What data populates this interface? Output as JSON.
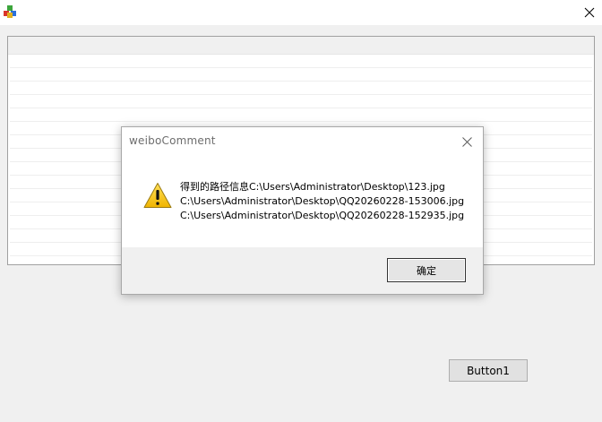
{
  "window": {
    "app_icon": "app-cube-icon",
    "close_icon": "close-icon"
  },
  "form": {
    "button1_label": "Button1"
  },
  "dialog": {
    "title": "weiboComment",
    "icon": "warning-icon",
    "message_lines": [
      "得到的路径信息C:\\Users\\Administrator\\Desktop\\123.jpg",
      "C:\\Users\\Administrator\\Desktop\\QQ20260228-153006.jpg",
      "C:\\Users\\Administrator\\Desktop\\QQ20260228-152935.jpg"
    ],
    "ok_label": "确定"
  },
  "colors": {
    "warning_yellow": "#f5c400",
    "dialog_footer": "#f0f0f0",
    "window_bg": "#f0f0f0"
  }
}
